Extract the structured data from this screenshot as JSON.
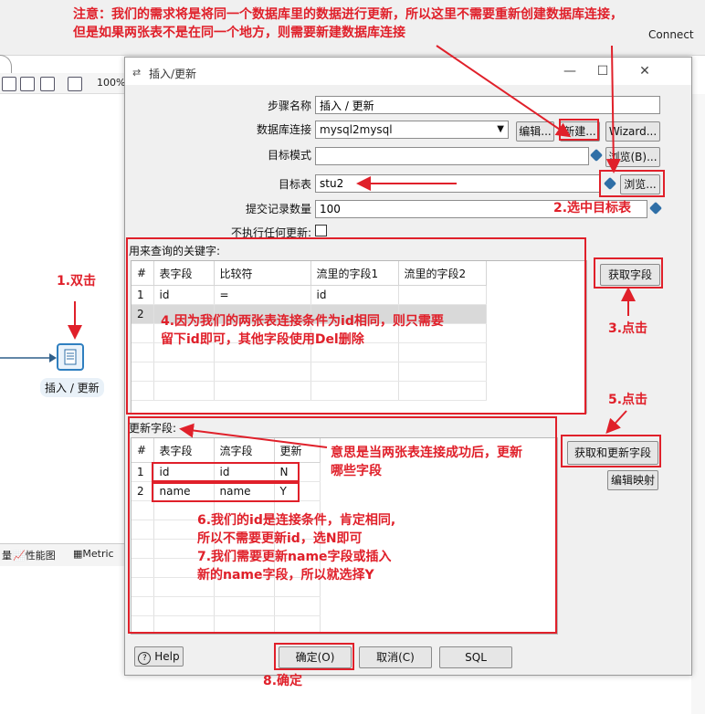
{
  "background": {
    "connect_label": "Connect",
    "zoom": "100%",
    "node_label": "插入 / 更新",
    "tab_perf": "性能图",
    "tab_metrics": "Metric"
  },
  "dialog": {
    "title": "插入/更新",
    "step_name_label": "步骤名称",
    "step_name_value": "插入 / 更新",
    "db_conn_label": "数据库连接",
    "db_conn_value": "mysql2mysql",
    "edit_btn": "编辑...",
    "new_btn": "新建...",
    "wizard_btn": "Wizard...",
    "target_schema_label": "目标模式",
    "target_schema_value": "",
    "browse_b_btn": "浏览(B)...",
    "target_table_label": "目标表",
    "target_table_value": "stu2",
    "browse_btn": "浏览...",
    "commit_size_label": "提交记录数量",
    "commit_size_value": "100",
    "no_update_label": "不执行任何更新:",
    "keys_section_label": "用来查询的关键字:",
    "keys_columns": [
      "#",
      "表字段",
      "比较符",
      "流里的字段1",
      "流里的字段2"
    ],
    "keys_rows": [
      [
        "1",
        "id",
        "=",
        "id",
        ""
      ],
      [
        "2",
        "",
        "",
        "",
        ""
      ]
    ],
    "get_fields_btn": "获取字段",
    "update_section_label": "更新字段:",
    "update_columns": [
      "#",
      "表字段",
      "流字段",
      "更新"
    ],
    "update_rows": [
      [
        "1",
        "id",
        "id",
        "N"
      ],
      [
        "2",
        "name",
        "name",
        "Y"
      ]
    ],
    "get_update_fields_btn": "获取和更新字段",
    "edit_mapping_btn": "编辑映射",
    "help_btn": "Help",
    "ok_btn": "确定(O)",
    "cancel_btn": "取消(C)",
    "sql_btn": "SQL"
  },
  "annotations": {
    "top_note_line1": "注意：我们的需求将是将同一个数据库里的数据进行更新，所以这里不需要重新创建数据库连接，",
    "top_note_line2": "但是如果两张表不是在同一个地方，则需要新建数据库连接",
    "step1": "1.双击",
    "step2": "2.选中目标表",
    "step3": "3.点击",
    "step4_line1": "4.因为我们的两张表连接条件为id相同，则只需要",
    "step4_line2": "留下id即可，其他字段使用Del删除",
    "step5": "5.点击",
    "meaning_line1": "意思是当两张表连接成功后，更新",
    "meaning_line2": "哪些字段",
    "step6_line1": "6.我们的id是连接条件，肯定相同,",
    "step6_line2": "所以不需要更新id，选N即可",
    "step7_line1": "7.我们需要更新name字段或插入",
    "step7_line2": "新的name字段，所以就选择Y",
    "step8": "8.确定"
  }
}
